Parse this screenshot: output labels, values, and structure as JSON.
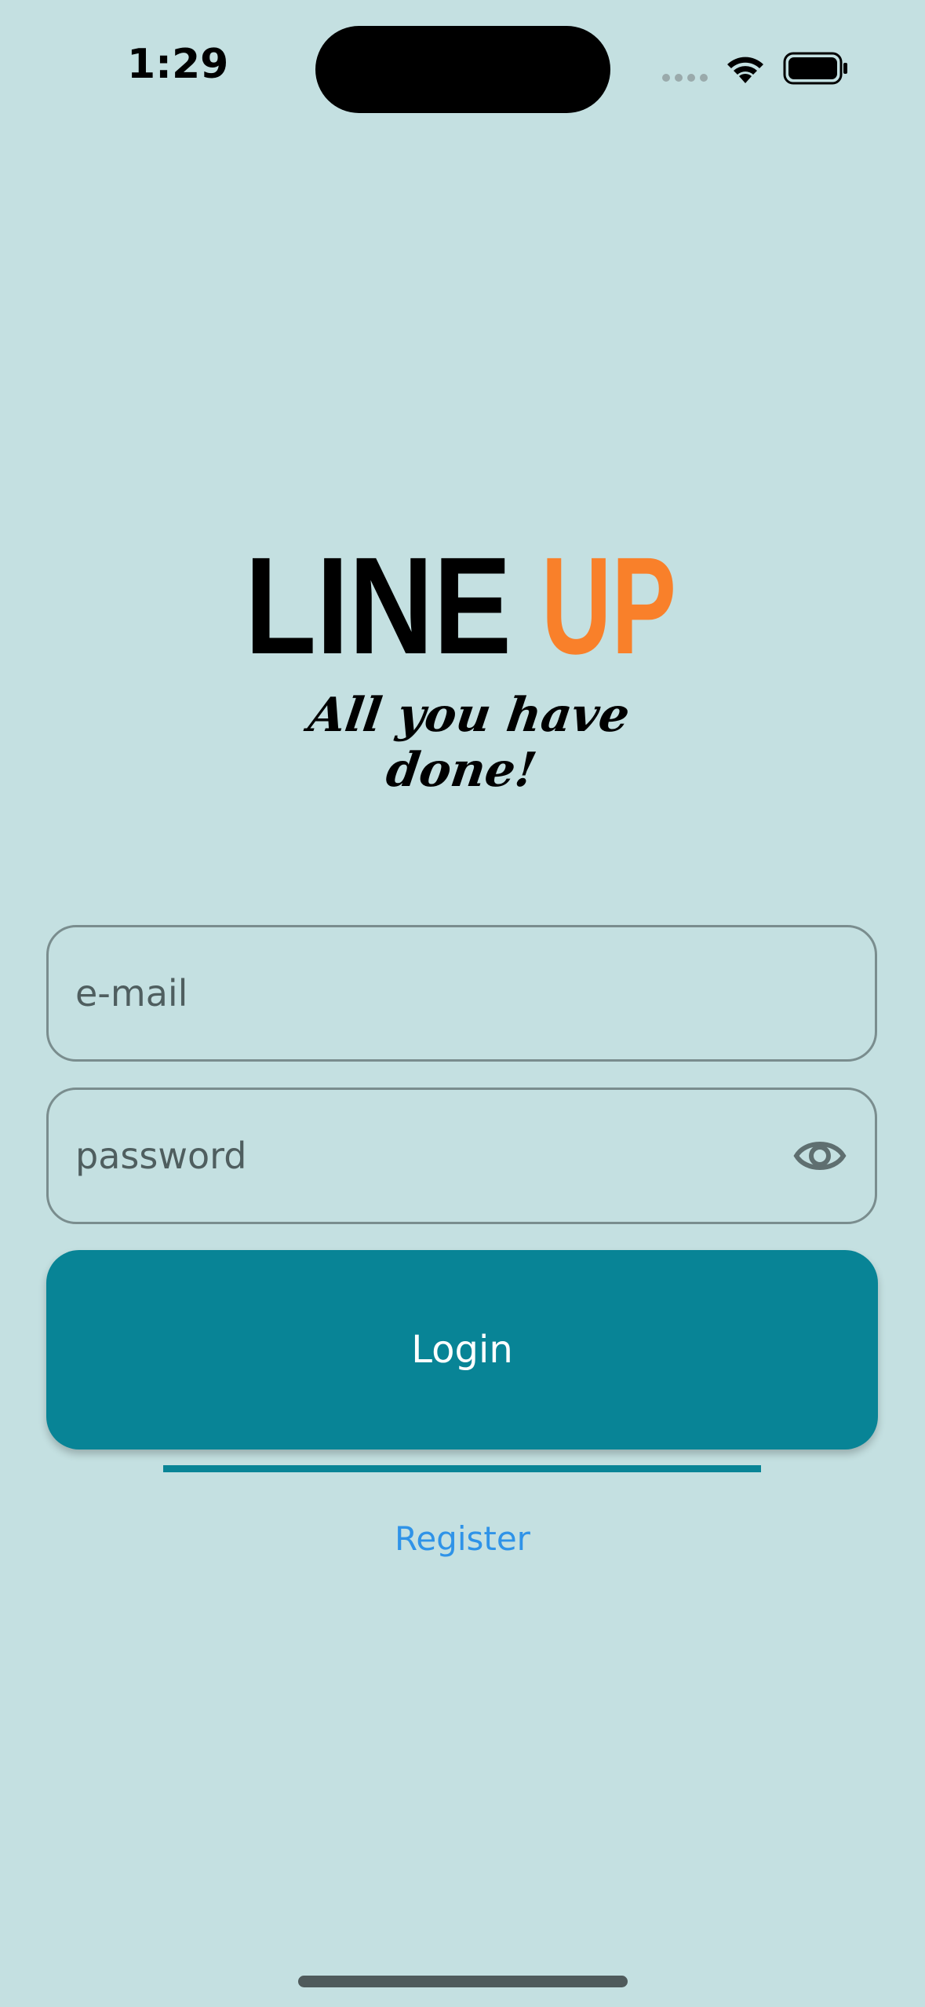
{
  "status_bar": {
    "time": "1:29"
  },
  "logo": {
    "word_part1": "LINE",
    "word_part2": "UP",
    "tagline": "All you have done!",
    "accent_color": "#f9802a"
  },
  "form": {
    "email_placeholder": "e-mail",
    "email_value": "",
    "password_placeholder": "password",
    "password_value": "",
    "password_toggle_icon": "eye-icon"
  },
  "actions": {
    "login_label": "Login",
    "register_label": "Register"
  },
  "colors": {
    "background": "#c4e0e1",
    "primary": "#088496",
    "link": "#2f93e8"
  }
}
